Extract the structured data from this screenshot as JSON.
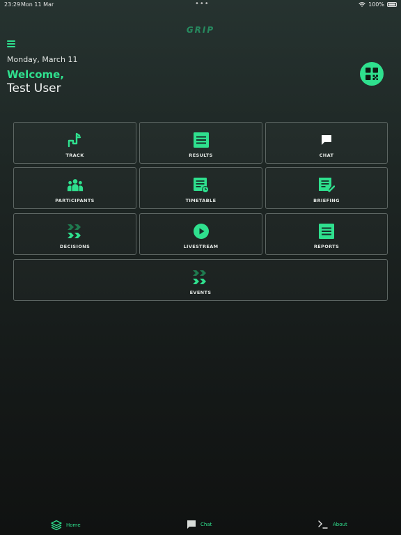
{
  "status_bar": {
    "time": "23:29",
    "date": "Mon 11 Mar",
    "dots": "•••",
    "battery": "100%",
    "battery_level": 1.0
  },
  "header": {
    "logo_text": "GRIP",
    "date": "Monday, March 11",
    "welcome": "Welcome,",
    "username": "Test User"
  },
  "tiles": [
    {
      "label": "TRACK",
      "icon": "track-icon"
    },
    {
      "label": "RESULTS",
      "icon": "results-icon"
    },
    {
      "label": "CHAT",
      "icon": "chat-bubble-icon"
    },
    {
      "label": "PARTICIPANTS",
      "icon": "participants-icon"
    },
    {
      "label": "TIMETABLE",
      "icon": "timetable-icon"
    },
    {
      "label": "BRIEFING",
      "icon": "briefing-icon"
    },
    {
      "label": "DECISIONS",
      "icon": "decisions-icon"
    },
    {
      "label": "LIVESTREAM",
      "icon": "livestream-icon"
    },
    {
      "label": "REPORTS",
      "icon": "reports-icon"
    },
    {
      "label": "EVENTS",
      "icon": "events-icon"
    }
  ],
  "tabbar": {
    "home": "Home",
    "chat": "Chat",
    "about": "About"
  },
  "colors": {
    "accent": "#2fe08e",
    "background_top": "#263330",
    "background_bottom": "#101211",
    "tile_border": "#5d6663"
  }
}
